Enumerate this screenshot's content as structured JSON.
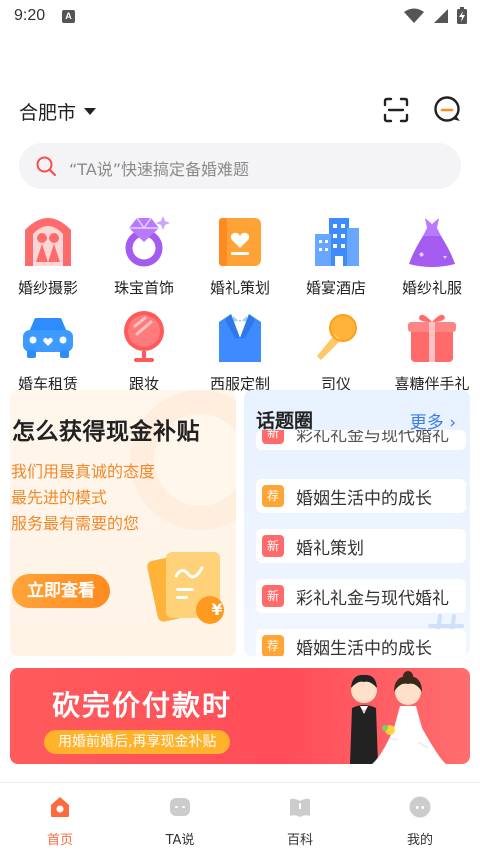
{
  "status": {
    "time": "9:20"
  },
  "header": {
    "city": "合肥市"
  },
  "search": {
    "placeholder": "“TA说”快速搞定备婚难题"
  },
  "categories": [
    {
      "label": "婚纱摄影",
      "icon": "wedding-photo-icon"
    },
    {
      "label": "珠宝首饰",
      "icon": "ring-icon"
    },
    {
      "label": "婚礼策划",
      "icon": "wedding-plan-icon"
    },
    {
      "label": "婚宴酒店",
      "icon": "hotel-icon"
    },
    {
      "label": "婚纱礼服",
      "icon": "dress-icon"
    },
    {
      "label": "婚车租赁",
      "icon": "car-icon"
    },
    {
      "label": "跟妆",
      "icon": "mirror-icon"
    },
    {
      "label": "西服定制",
      "icon": "suit-icon"
    },
    {
      "label": "司仪",
      "icon": "microphone-icon"
    },
    {
      "label": "喜糖伴手礼",
      "icon": "gift-icon"
    }
  ],
  "promo": {
    "title": "怎么获得现金补贴",
    "lines": [
      "我们用最真诚的态度",
      "最先进的模式",
      "服务最有需要的您"
    ],
    "button": "立即查看",
    "badge": "¥"
  },
  "topics": {
    "logo": "话题圈",
    "more": "更多",
    "items": [
      {
        "tag": "新",
        "text": "彩礼礼金与现代婚礼",
        "color": "#ff6b6b"
      },
      {
        "tag": "荐",
        "text": "婚姻生活中的成长",
        "color": "#ffa533"
      },
      {
        "tag": "新",
        "text": "婚礼策划",
        "color": "#ff6b6b"
      },
      {
        "tag": "新",
        "text": "彩礼礼金与现代婚礼",
        "color": "#ff6b6b"
      },
      {
        "tag": "荐",
        "text": "婚姻生活中的成长",
        "color": "#ffa533"
      }
    ]
  },
  "banner": {
    "title": "砍完价付款时",
    "subtitle": "用婚前婚后,再享现金补贴"
  },
  "tabs": [
    {
      "label": "首页",
      "icon": "home-icon",
      "active": true
    },
    {
      "label": "TA说",
      "icon": "chat-icon",
      "active": false
    },
    {
      "label": "百科",
      "icon": "book-icon",
      "active": false
    },
    {
      "label": "我的",
      "icon": "profile-icon",
      "active": false
    }
  ],
  "colors": {
    "accent": "#ff6a3d",
    "orange": "#f08a2c",
    "blue": "#3a7bf0",
    "red": "#ff5b5b"
  }
}
